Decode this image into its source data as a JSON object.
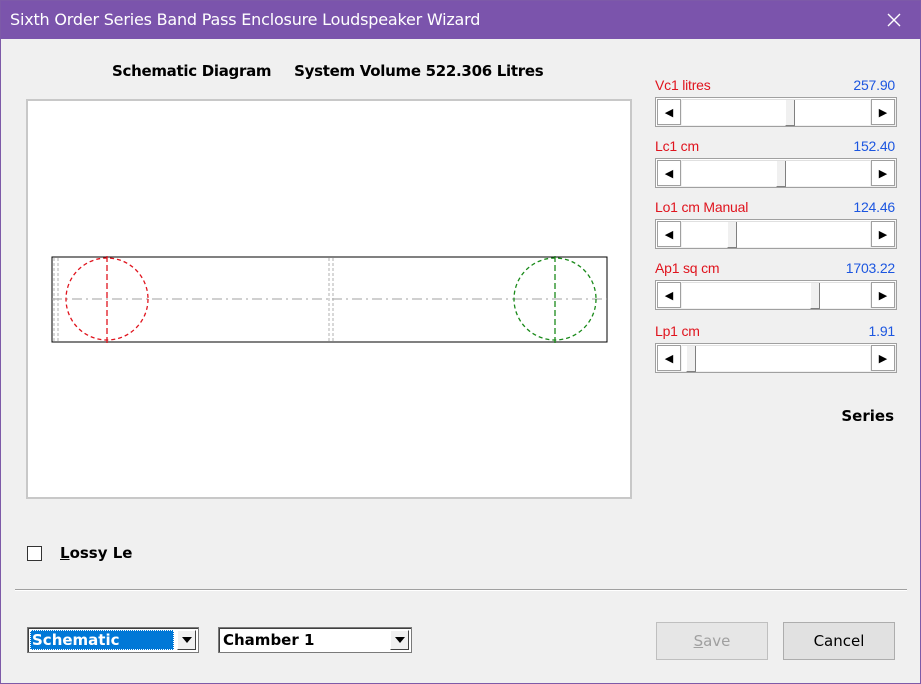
{
  "window": {
    "title": "Sixth Order Series Band Pass Enclosure Loudspeaker Wizard",
    "close_icon": "close-icon"
  },
  "heading": {
    "diagram_label": "Schematic Diagram",
    "volume_label": "System Volume 522.306 Litres"
  },
  "params": [
    {
      "label": "Vc1  litres",
      "value": "257.90",
      "position": 0.58
    },
    {
      "label": "Lc1  cm",
      "value": "152.40",
      "position": 0.53
    },
    {
      "label": "Lo1  cm  Manual",
      "value": "124.46",
      "position": 0.25
    },
    {
      "label": "Ap1  sq cm",
      "value": "1703.22",
      "position": 0.72
    },
    {
      "label": "Lp1  cm",
      "value": "1.91",
      "position": 0.02
    }
  ],
  "series_label": "Series",
  "lossy": {
    "label_accel": "L",
    "label_rest": "ossy Le",
    "checked": false
  },
  "combos": {
    "view": "Schematic",
    "chamber": "Chamber 1"
  },
  "buttons": {
    "save_accel": "S",
    "save_rest": "ave",
    "cancel": "Cancel"
  },
  "colors": {
    "title_bar": "#7b54ac",
    "label_red": "#e0141e",
    "value_blue": "#1c56e0",
    "driver_red": "#e0141e",
    "port_green": "#1a8a1a"
  }
}
